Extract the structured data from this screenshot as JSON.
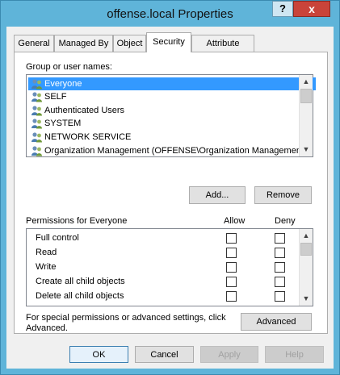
{
  "window": {
    "title": "offense.local Properties",
    "help_label": "?",
    "close_label": "x"
  },
  "tabs": [
    {
      "label": "General",
      "active": false
    },
    {
      "label": "Managed By",
      "active": false
    },
    {
      "label": "Object",
      "active": false
    },
    {
      "label": "Security",
      "active": true
    },
    {
      "label": "Attribute Editor",
      "active": false
    }
  ],
  "security": {
    "group_label": "Group or user names:",
    "users": [
      {
        "name": "Everyone",
        "selected": true,
        "icon": "users-icon"
      },
      {
        "name": "SELF",
        "selected": false,
        "icon": "users-icon"
      },
      {
        "name": "Authenticated Users",
        "selected": false,
        "icon": "users-icon"
      },
      {
        "name": "SYSTEM",
        "selected": false,
        "icon": "users-icon"
      },
      {
        "name": "NETWORK SERVICE",
        "selected": false,
        "icon": "users-icon"
      },
      {
        "name": "Organization Management (OFFENSE\\Organization Management)",
        "selected": false,
        "icon": "users-icon"
      }
    ],
    "add_label": "Add...",
    "remove_label": "Remove",
    "permissions_label": "Permissions for Everyone",
    "allow_header": "Allow",
    "deny_header": "Deny",
    "permissions": [
      {
        "name": "Full control",
        "allow": false,
        "deny": false
      },
      {
        "name": "Read",
        "allow": false,
        "deny": false
      },
      {
        "name": "Write",
        "allow": false,
        "deny": false
      },
      {
        "name": "Create all child objects",
        "allow": false,
        "deny": false
      },
      {
        "name": "Delete all child objects",
        "allow": false,
        "deny": false
      }
    ],
    "special_text": "For special permissions or advanced settings, click Advanced.",
    "advanced_label": "Advanced"
  },
  "footer": {
    "ok_label": "OK",
    "cancel_label": "Cancel",
    "apply_label": "Apply",
    "help_label": "Help"
  },
  "colors": {
    "title_bar": "#5fb4d9",
    "close_button": "#c9443a",
    "selection": "#3399ff"
  }
}
